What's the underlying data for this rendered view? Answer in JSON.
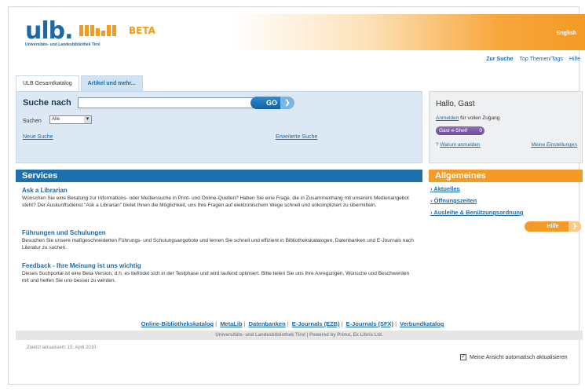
{
  "header": {
    "logo_text": "ulb.",
    "logo_beta": "BETA",
    "logo_subtitle": "Universitäts- und Landesbibliothek Tirol",
    "language_link": "English",
    "brand_colors": {
      "blue": "#1b6aa5",
      "orange": "#f49a26"
    }
  },
  "topnav": {
    "items": [
      "Zur Suche",
      "Top Themen/Tags",
      "Hilfe"
    ]
  },
  "tabs": [
    {
      "label": "ULB Gesamtkatalog",
      "active": true
    },
    {
      "label": "Artikel und mehr...",
      "active": false
    }
  ],
  "search": {
    "label": "Suche nach",
    "value": "",
    "go_label": "GO",
    "go_arrow_icon": "arrow-right-icon",
    "scope_label": "Suchen",
    "scope_selected": "Alle",
    "new_search": "Neue Suche",
    "advanced_search": "Erweiterte Suche"
  },
  "user": {
    "greeting": "Hallo, Gast",
    "login_link": "Anmelden",
    "login_suffix": "für vollen Zugang",
    "eshelf_label": "Gast e-Shelf",
    "eshelf_count": "0",
    "why_login": "Warum anmelden",
    "why_prefix": "?",
    "my_settings": "Meine Einstellungen"
  },
  "services": {
    "heading": "Services",
    "items": [
      {
        "title": "Ask a Librarian",
        "desc": "Wünschen Sie eine Beratung zur Informations- oder Mediensuche in Print- und Online-Quellen? Haben Sie eine Frage, die in Zusammenhang mit unserem Medienangebot steht? Der Auskunftsdienst \"Ask a Librarian\" bietet Ihnen die Möglichkeit, uns Ihre Fragen auf elektronischem Wege schnell und unkompliziert zu übermitteln."
      },
      {
        "title": "Führungen und Schulungen",
        "desc": "Besuchen Sie unsere maßgeschneiderten Führungs- und Schulungsangebote und lernen Sie schnell und effizient in Bibliothekskatalogen, Datenbanken und E-Journals nach Literatur zu suchen."
      },
      {
        "title": "Feedback - Ihre Meinung ist uns wichtig",
        "desc": "Dieses Suchportal ist eine Beta-Version, d.h. es befindet sich in der Testphase und wird laufend optimiert. Bitte teilen Sie uns Ihre Anregungen, Wünsche und Beschwerden mit und helfen Sie uns besser zu werden."
      }
    ]
  },
  "allgemeines": {
    "heading": "Allgemeines",
    "items": [
      "Aktuelles",
      "Öffnungszeiten",
      "Ausleihe & Benützungsordnung"
    ],
    "help_button": "Hilfe"
  },
  "footer": {
    "links": [
      "Online-Bibliothekskatalog",
      "MetaLib",
      "Datenbanken",
      "E-Journals (EZB)",
      "E-Journals (SFX)",
      "Verbundkatalog"
    ],
    "bar_text": "Universitäts- und Landesbibliothek Tirol | Powered by Primo, Ex Libris Ltd.",
    "last_updated": "Zuletzt aktualisiert: 15. April 2010",
    "auto_refresh_label": "Meine Ansicht automatisch aktualisieren",
    "auto_refresh_checked": true
  }
}
